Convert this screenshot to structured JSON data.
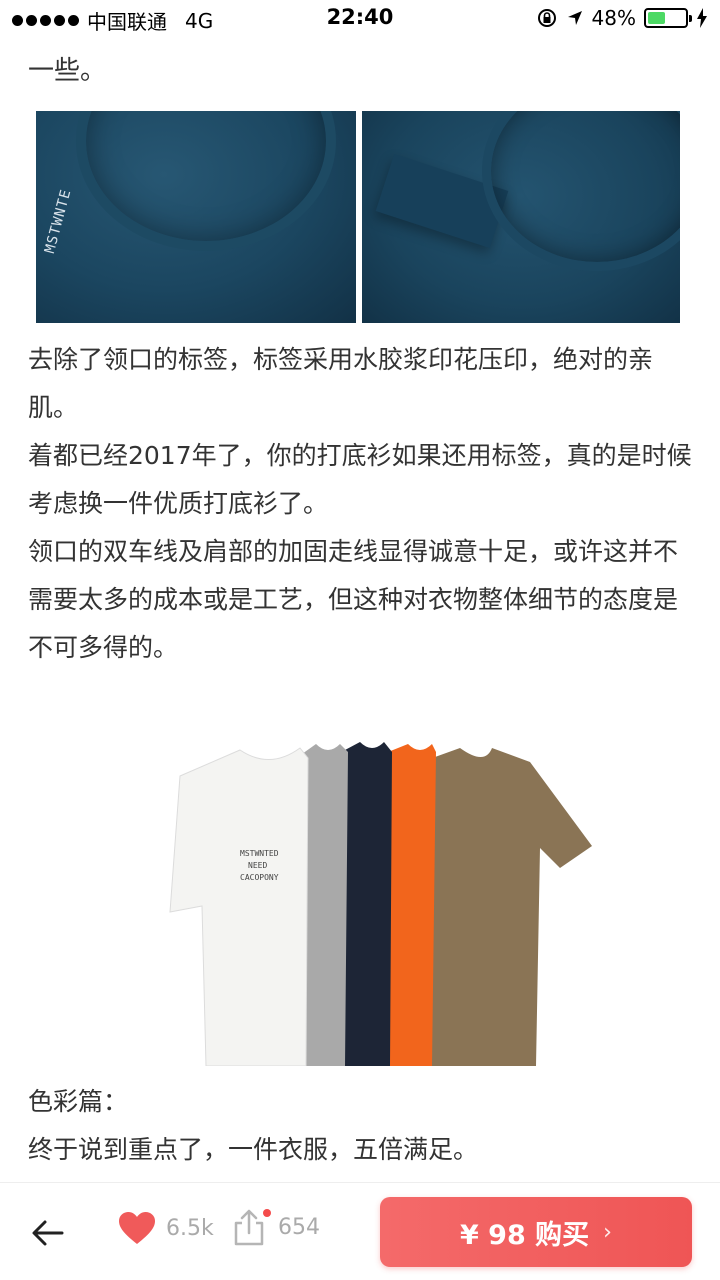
{
  "status_bar": {
    "carrier": "中国联通",
    "network": "4G",
    "time": "22:40",
    "battery_percent": "48%",
    "battery_level": 0.48,
    "battery_color": "#4cd964"
  },
  "article": {
    "top_text": "一些。",
    "photo_print": "MSTWNTE",
    "paragraphs": [
      "去除了领口的标签，标签采用水胶浆印花压印，绝对的亲肌。",
      "着都已经2017年了，你的打底衫如果还用标签，真的是时候考虑换一件优质打底衫了。",
      "领口的双车线及肩部的加固走线显得诚意十足，或许这并不需要太多的成本或是工艺，但这种对衣物整体细节的态度是不可多得的。"
    ],
    "shirt_print": [
      "MSTWNTED",
      "NEED",
      "CACOPONY"
    ],
    "section_title": "色彩篇：",
    "cut_line": "终于说到重点了，一件衣服，五倍满足。",
    "shirt_colors": [
      "#f4f4f2",
      "#a9a9a9",
      "#1d2536",
      "#f2651c",
      "#8a7455"
    ]
  },
  "bottom_bar": {
    "like_count": "6.5k",
    "share_count": "654",
    "buy_label": "¥ 98 购买",
    "buy_arrow": "›",
    "accent": "#f05a5a"
  }
}
